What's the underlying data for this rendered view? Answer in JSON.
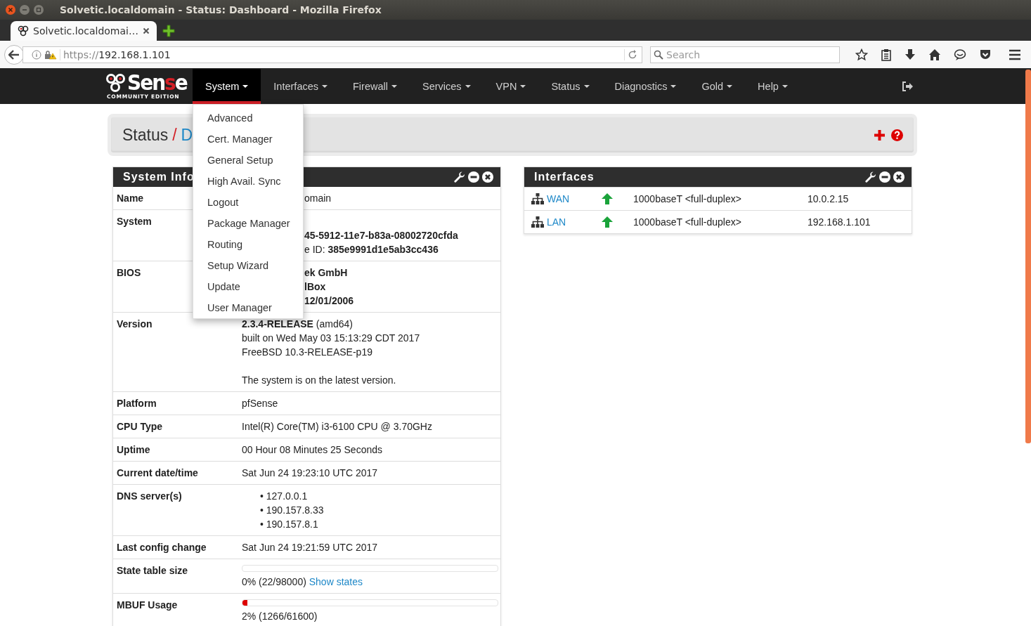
{
  "window": {
    "title": "Solvetic.localdomain - Status: Dashboard - Mozilla Firefox"
  },
  "tabs": [
    {
      "label": "Solvetic.localdomai…",
      "selected": true
    }
  ],
  "address_bar": {
    "scheme": "https://",
    "host": "192.168.1.101"
  },
  "search": {
    "placeholder": "Search"
  },
  "logo": {
    "wordmark": [
      {
        "text": "Sen",
        "accent": false
      },
      {
        "text": "s",
        "accent": true
      },
      {
        "text": "e",
        "accent": false
      }
    ],
    "subtitle": "COMMUNITY EDITION"
  },
  "nav": [
    {
      "label": "System",
      "selected": true
    },
    {
      "label": "Interfaces",
      "selected": false
    },
    {
      "label": "Firewall",
      "selected": false
    },
    {
      "label": "Services",
      "selected": false
    },
    {
      "label": "VPN",
      "selected": false
    },
    {
      "label": "Status",
      "selected": false
    },
    {
      "label": "Diagnostics",
      "selected": false
    },
    {
      "label": "Gold",
      "selected": false
    },
    {
      "label": "Help",
      "selected": false
    }
  ],
  "system_menu": [
    "Advanced",
    "Cert. Manager",
    "General Setup",
    "High Avail. Sync",
    "Logout",
    "Package Manager",
    "Routing",
    "Setup Wizard",
    "Update",
    "User Manager"
  ],
  "breadcrumb": {
    "section": "Status",
    "separator": "/",
    "page": "D"
  },
  "system_info": {
    "title": "System Info",
    "rows": [
      {
        "label": "Name",
        "kind": "clipped",
        "lines": [
          {
            "text": "omain",
            "bold": false
          }
        ]
      },
      {
        "label": "System",
        "kind": "clipped",
        "first_line_covered": true,
        "lines": [
          {
            "text": "45-5912-11e7-b83a-08002720cfda",
            "bold": true
          },
          {
            "text": "e ID: **385e9991d1e5ab3cc436**",
            "bold": false
          }
        ]
      },
      {
        "label": "BIOS",
        "kind": "clipped",
        "lines": [
          {
            "text": "ek GmbH",
            "bold": true
          },
          {
            "text": "lBox",
            "bold": true
          },
          {
            "text": "12/01/2006",
            "bold": true
          }
        ]
      },
      {
        "label": "Version",
        "kind": "text",
        "lines": [
          {
            "text": "**2.3.4-RELEASE** (amd64)",
            "bold": false
          },
          {
            "text": "built on Wed May 03 15:13:29 CDT 2017",
            "bold": false
          },
          {
            "text": "FreeBSD 10.3-RELEASE-p19",
            "bold": false
          }
        ],
        "note": "The system is on the latest version."
      },
      {
        "label": "Platform",
        "kind": "text",
        "lines": [
          {
            "text": "pfSense",
            "bold": false
          }
        ]
      },
      {
        "label": "CPU Type",
        "kind": "text",
        "lines": [
          {
            "text": "Intel(R) Core(TM) i3-6100 CPU @ 3.70GHz",
            "bold": false
          }
        ]
      },
      {
        "label": "Uptime",
        "kind": "text",
        "lines": [
          {
            "text": "00 Hour 08 Minutes 25 Seconds",
            "bold": false
          }
        ]
      },
      {
        "label": "Current date/time",
        "kind": "text",
        "lines": [
          {
            "text": "Sat Jun 24 19:23:10 UTC 2017",
            "bold": false
          }
        ]
      },
      {
        "label": "DNS server(s)",
        "kind": "list",
        "items": [
          "• 127.0.0.1",
          "• 190.157.8.33",
          "• 190.157.8.1"
        ]
      },
      {
        "label": "Last config change",
        "kind": "text",
        "lines": [
          {
            "text": "Sat Jun 24 19:21:59 UTC 2017",
            "bold": false
          }
        ]
      },
      {
        "label": "State table size",
        "kind": "meter",
        "level": 0,
        "reading": "0% (22/98000)",
        "link": "Show states"
      },
      {
        "label": "MBUF Usage",
        "kind": "meter",
        "level": 0.02,
        "reading": "2% (1266/61600)"
      }
    ]
  },
  "interfaces": {
    "title": "Interfaces",
    "rows": [
      {
        "name": "WAN",
        "up": true,
        "media": "1000baseT <full-duplex>",
        "address": "10.0.2.15"
      },
      {
        "name": "LAN",
        "up": true,
        "media": "1000baseT <full-duplex>",
        "address": "192.168.1.101"
      }
    ]
  }
}
